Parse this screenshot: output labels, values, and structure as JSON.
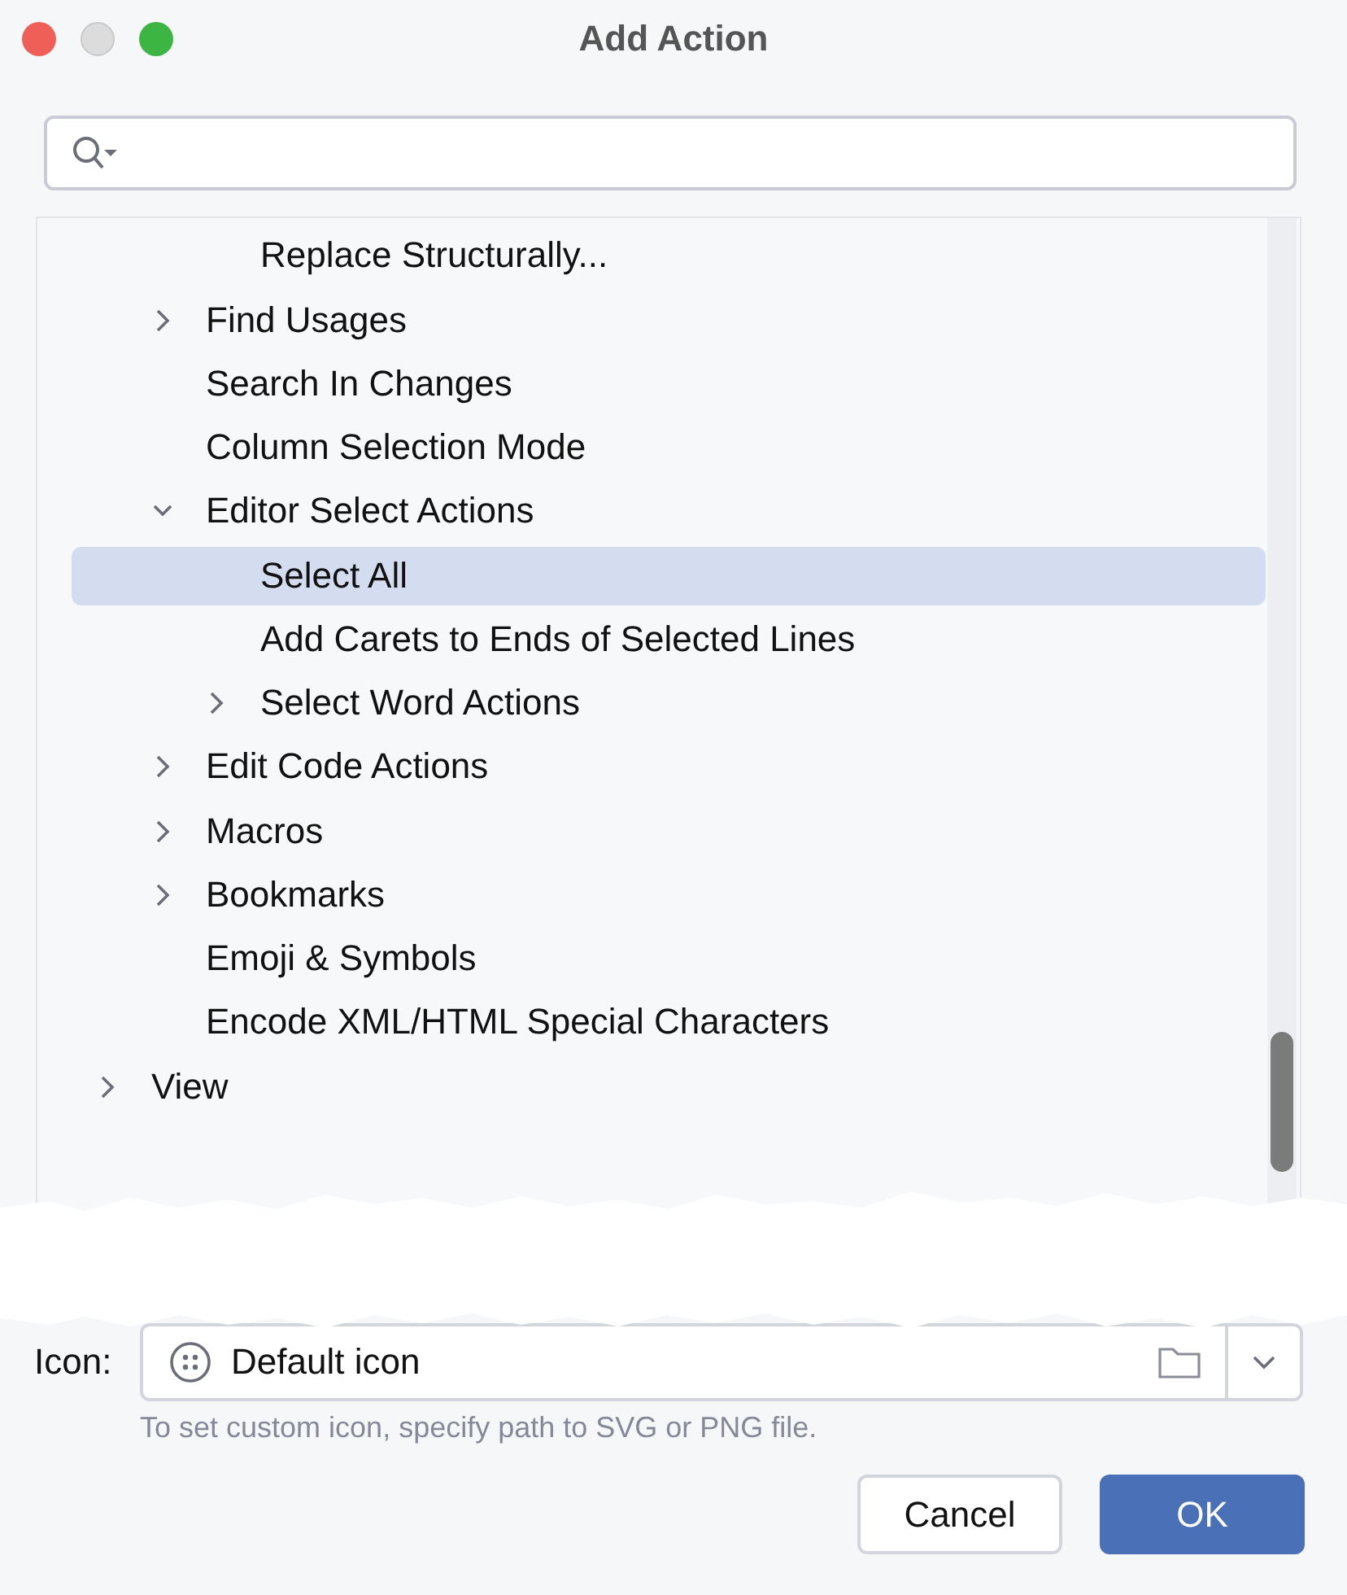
{
  "window": {
    "title": "Add Action"
  },
  "tree": {
    "items": [
      {
        "kind": "group",
        "children": [
          {
            "kind": "group",
            "children": [
              {
                "kind": "leaf",
                "label": "Replace Structurally...",
                "selected": false
              }
            ]
          },
          {
            "kind": "folder",
            "label": "Find Usages",
            "expanded": false,
            "selected": false
          },
          {
            "kind": "leaf",
            "label": "Search In Changes",
            "selected": false
          },
          {
            "kind": "leaf",
            "label": "Column Selection Mode",
            "selected": false
          },
          {
            "kind": "folder",
            "label": "Editor Select Actions",
            "expanded": true,
            "selected": false,
            "children": [
              {
                "kind": "leaf",
                "label": "Select All",
                "selected": true
              },
              {
                "kind": "leaf",
                "label": "Add Carets to Ends of Selected Lines",
                "selected": false
              },
              {
                "kind": "folder",
                "label": "Select Word Actions",
                "expanded": false,
                "selected": false
              }
            ]
          },
          {
            "kind": "folder",
            "label": "Edit Code Actions",
            "expanded": false,
            "selected": false
          },
          {
            "kind": "folder",
            "label": "Macros",
            "expanded": false,
            "selected": false
          },
          {
            "kind": "folder",
            "label": "Bookmarks",
            "expanded": false,
            "selected": false
          },
          {
            "kind": "leaf",
            "label": "Emoji & Symbols",
            "selected": false
          },
          {
            "kind": "leaf",
            "label": "Encode XML/HTML Special Characters",
            "selected": false
          }
        ]
      },
      {
        "kind": "folder",
        "label": "View",
        "expanded": false,
        "selected": false
      }
    ]
  },
  "icon_field": {
    "label": "Icon:",
    "value": "Default icon",
    "hint": "To set custom icon, specify path to SVG or PNG file."
  },
  "buttons": [
    {
      "label": "Cancel",
      "kind": "secondary"
    },
    {
      "label": "OK",
      "kind": "primary"
    }
  ]
}
